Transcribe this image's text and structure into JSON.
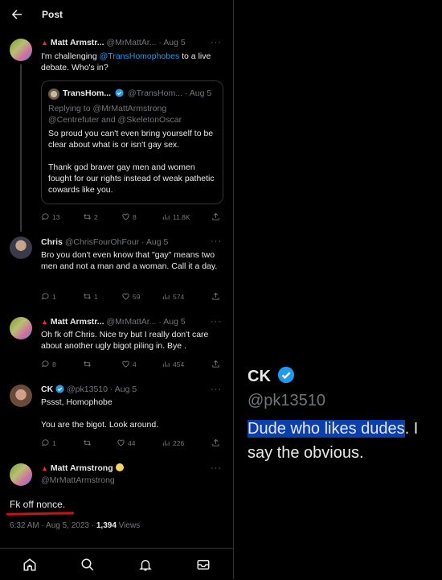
{
  "header": {
    "title": "Post"
  },
  "tweets": [
    {
      "name": "Matt Armstr...",
      "handle": "@MrMattAr...",
      "date": "· Aug 5",
      "body_pre": "I'm challenging ",
      "mention": "@TransHomophobes",
      "body_post": " to a live debate. Who's in?",
      "quote": {
        "name": "TransHom...",
        "handle": "@TransHom...",
        "date": "· Aug 5",
        "reply_line1": "Replying to @MrMattArmstrong",
        "reply_line2": "@Centrefuter and @SkeletonOscar",
        "text": "So proud you can't even bring yourself to be clear about what is or isn't gay sex.\n\nThank god braver gay men and women fought for our rights instead of weak pathetic cowards like you."
      },
      "stats": {
        "replies": "13",
        "reposts": "2",
        "likes": "8",
        "views": "11.8K"
      }
    },
    {
      "name": "Chris",
      "handle": "@ChrisFourOhFour",
      "date": "· Aug 5",
      "text": "Bro you don't even know that \"gay\" means two men and not a man and a woman. Call it a day.",
      "stats": {
        "replies": "1",
        "reposts": "1",
        "likes": "59",
        "views": "574"
      }
    },
    {
      "name": "Matt Armstr...",
      "handle": "@MrMattAr...",
      "date": "· Aug 5",
      "text": "Oh fk off Chris. Nice try but I really don't care about another ugly bigot piling in. Bye .",
      "stats": {
        "replies": "8",
        "reposts": "",
        "likes": "4",
        "views": "454"
      }
    },
    {
      "name": "CK",
      "handle": "@pk13510",
      "date": "· Aug 5",
      "text": "Pssst, Homophobe\n\nYou are the bigot. Look around.",
      "stats": {
        "replies": "1",
        "reposts": "",
        "likes": "44",
        "views": "226"
      }
    }
  ],
  "main_post": {
    "name": "Matt Armstrong",
    "handle": "@MrMattArmstrong",
    "text": "Fk off nonce.",
    "time": "6:32 AM · Aug 5, 2023 · ",
    "views_count": "1,394",
    "views_label": " Views"
  },
  "more": "···",
  "right_panel": {
    "name": "CK",
    "handle": "@pk13510",
    "bio_highlight": "Dude who likes dudes",
    "bio_rest": ". I",
    "bio_line2": "say the obvious."
  },
  "colors": {
    "accent": "#1d9bf0",
    "muted": "#71767b",
    "text": "#e7e9ea",
    "highlight": "#0b3fae",
    "underline": "#d01010"
  },
  "icons": [
    "back-arrow-icon",
    "verified-icon",
    "reply-icon",
    "repost-icon",
    "like-icon",
    "views-icon",
    "share-icon",
    "home-icon",
    "search-icon",
    "notifications-icon",
    "messages-icon"
  ]
}
